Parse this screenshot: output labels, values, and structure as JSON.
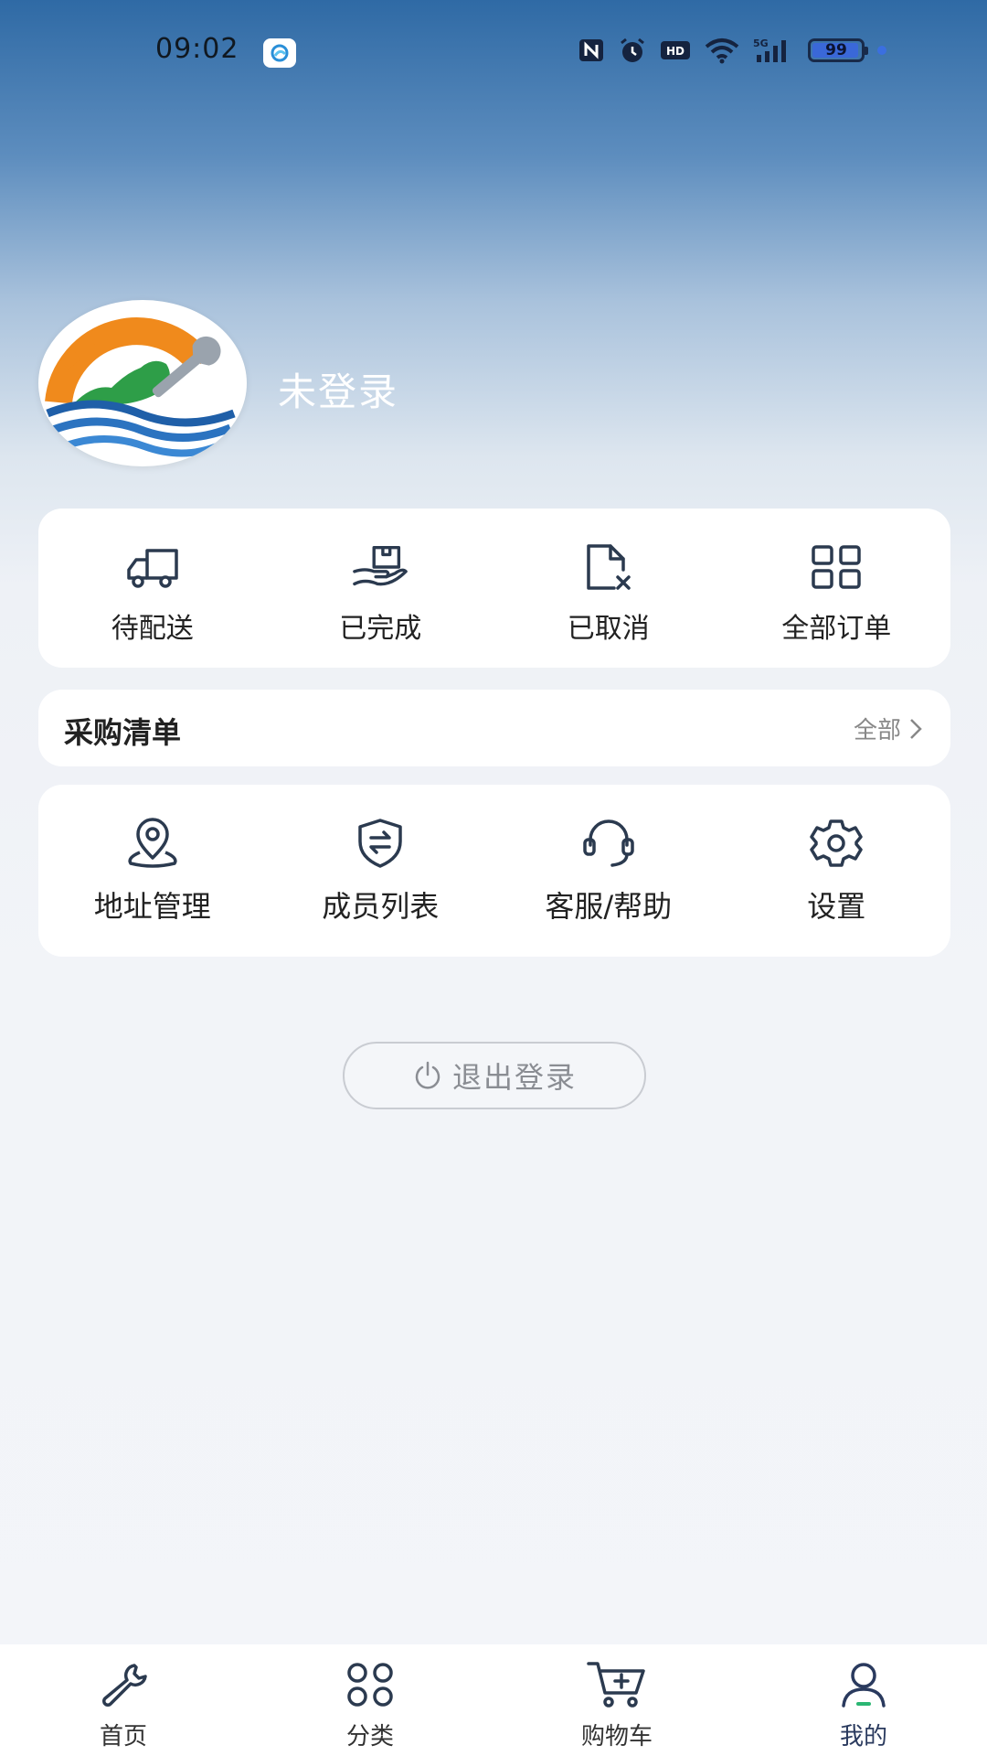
{
  "status_bar": {
    "time": "09:02",
    "battery": "99"
  },
  "profile": {
    "name": "未登录"
  },
  "orders": {
    "items": [
      {
        "label": "待配送",
        "icon": "truck-icon"
      },
      {
        "label": "已完成",
        "icon": "hand-box-icon"
      },
      {
        "label": "已取消",
        "icon": "document-cancel-icon"
      },
      {
        "label": "全部订单",
        "icon": "grid-icon"
      }
    ]
  },
  "purchase_list": {
    "title": "采购清单",
    "all_label": "全部"
  },
  "services": {
    "items": [
      {
        "label": "地址管理",
        "icon": "location-pin-icon"
      },
      {
        "label": "成员列表",
        "icon": "shield-swap-icon"
      },
      {
        "label": "客服/帮助",
        "icon": "headset-icon"
      },
      {
        "label": "设置",
        "icon": "gear-icon"
      }
    ]
  },
  "logout": {
    "label": "退出登录"
  },
  "tabbar": {
    "items": [
      {
        "label": "首页",
        "icon": "wrench-icon"
      },
      {
        "label": "分类",
        "icon": "category-icon"
      },
      {
        "label": "购物车",
        "icon": "cart-icon"
      },
      {
        "label": "我的",
        "icon": "user-icon"
      }
    ]
  },
  "colors": {
    "accent": "#2a3a5e",
    "active_indicator": "#2bb673",
    "header_top": "#2f6aa5"
  }
}
